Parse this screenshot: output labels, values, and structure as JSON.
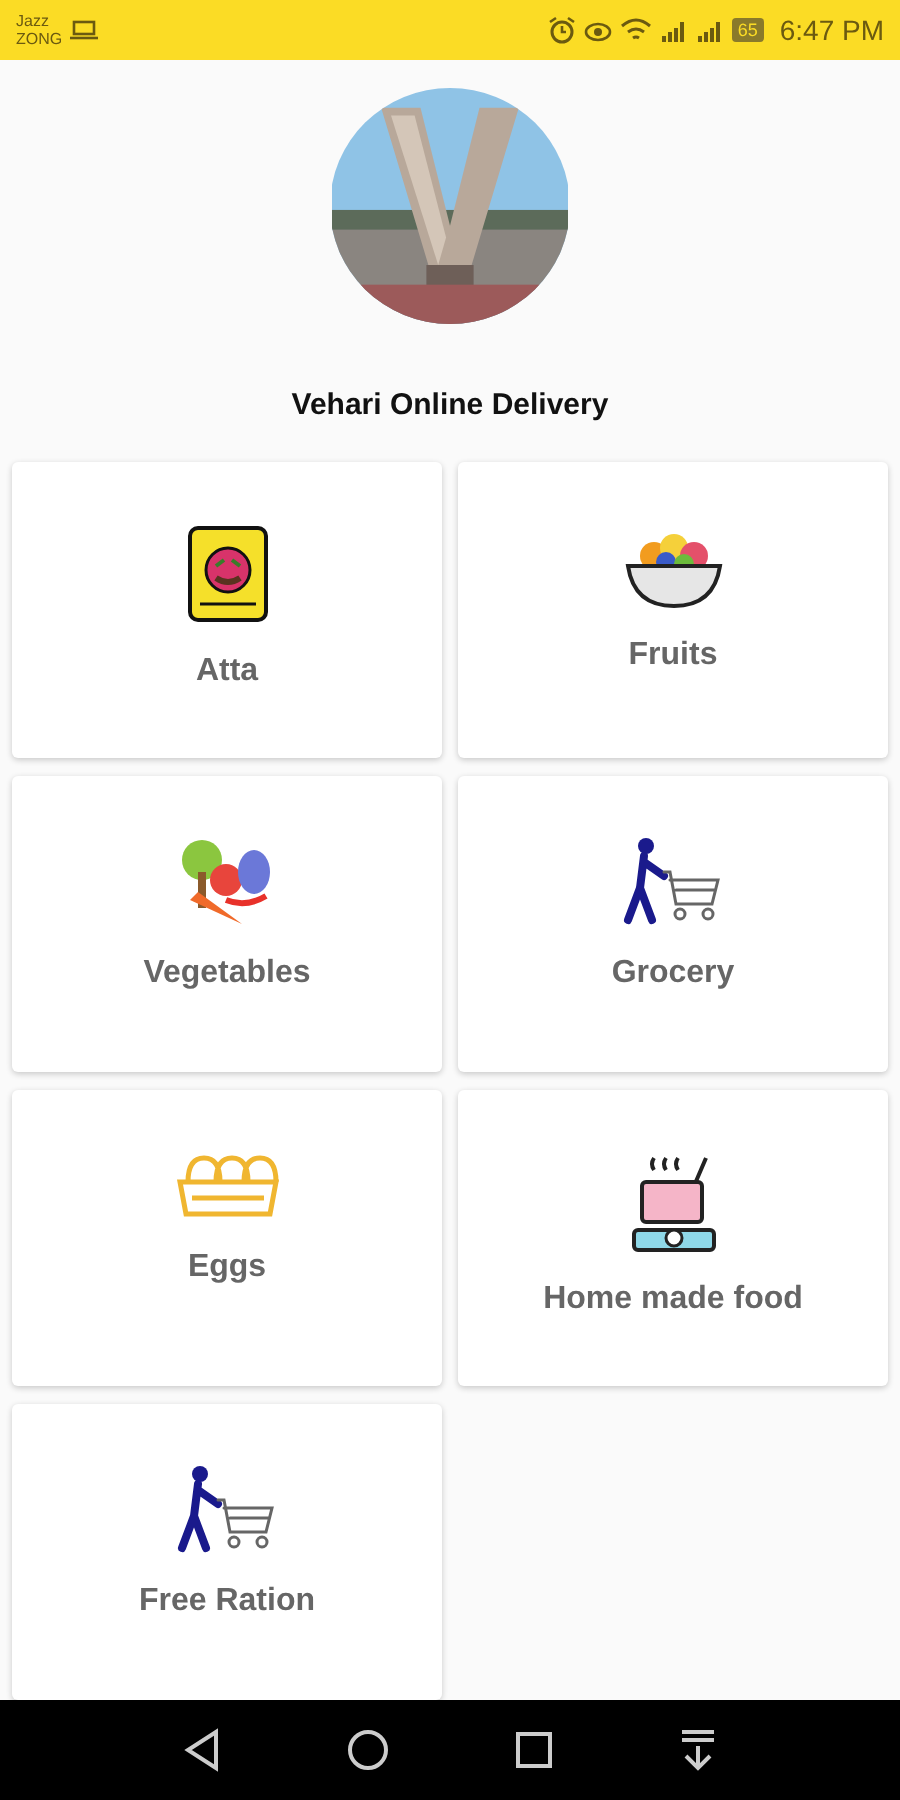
{
  "status_bar": {
    "carrier_lines": [
      "Jazz",
      "ZONG"
    ],
    "battery": "65",
    "time": "6:47 PM"
  },
  "header": {
    "title": "Vehari Online Delivery"
  },
  "categories": [
    {
      "label": "Atta"
    },
    {
      "label": "Fruits"
    },
    {
      "label": "Vegetables"
    },
    {
      "label": "Grocery"
    },
    {
      "label": "Eggs"
    },
    {
      "label": "Home made food"
    },
    {
      "label": "Free Ration"
    }
  ]
}
